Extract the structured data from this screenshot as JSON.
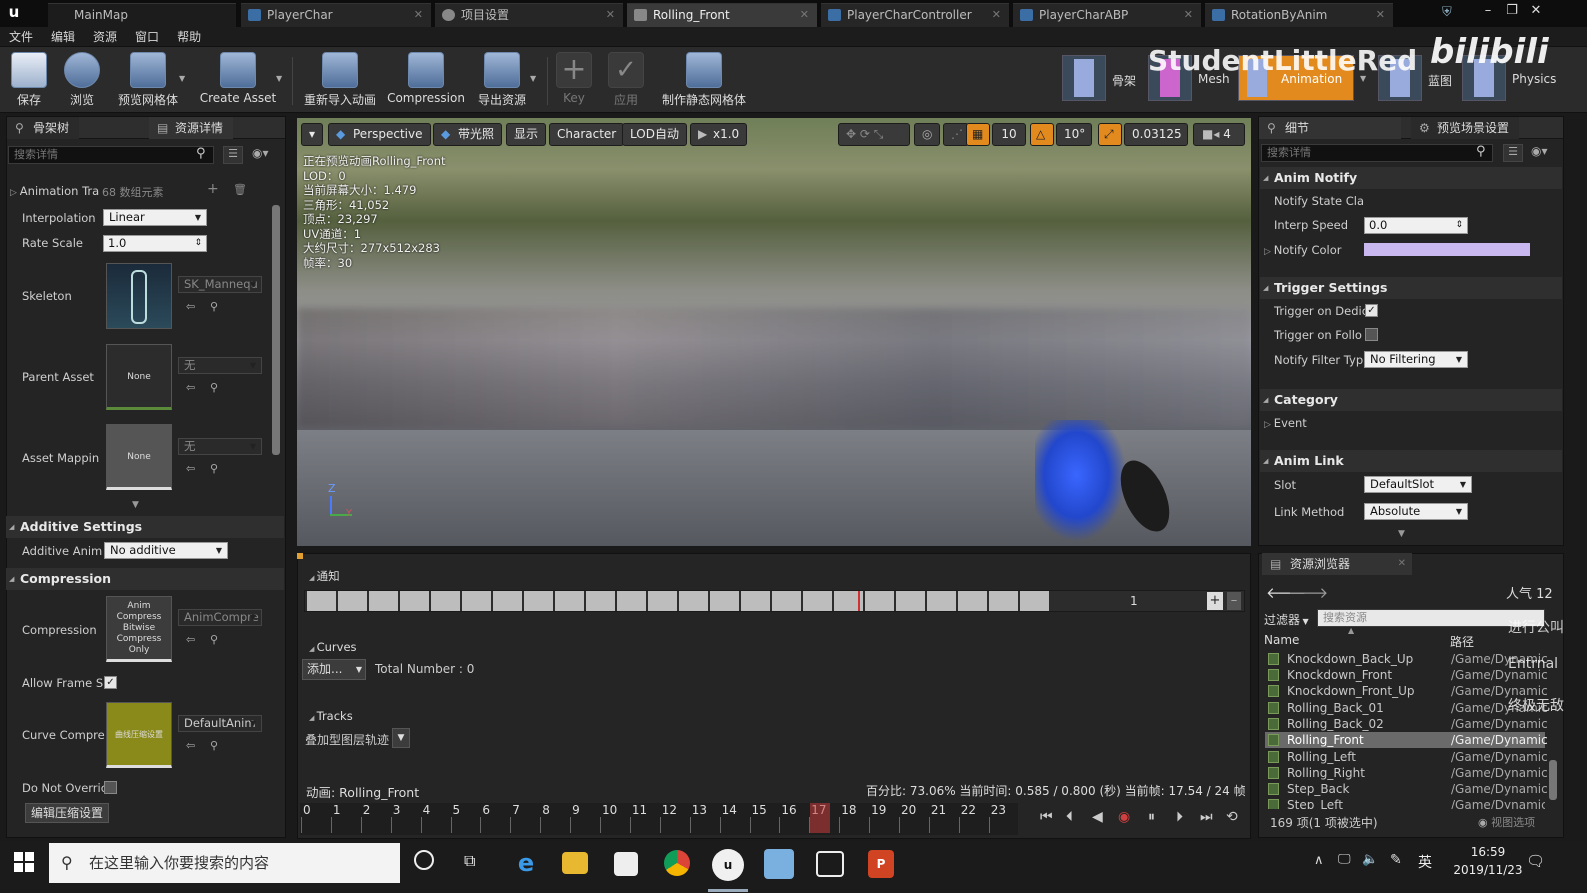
{
  "title_tabs": [
    {
      "label": "MainMap"
    },
    {
      "label": "PlayerChar"
    },
    {
      "label": "项目设置"
    },
    {
      "label": "Rolling_Front"
    },
    {
      "label": "PlayerCharController"
    },
    {
      "label": "PlayerCharABP"
    },
    {
      "label": "RotationByAnim"
    }
  ],
  "menu": [
    "文件",
    "编辑",
    "资源",
    "窗口",
    "帮助"
  ],
  "toolbar": [
    {
      "label": "保存"
    },
    {
      "label": "浏览"
    },
    {
      "label": "预览网格体"
    },
    {
      "label": "Create Asset"
    },
    {
      "label": "重新导入动画"
    },
    {
      "label": "Compression"
    },
    {
      "label": "导出资源"
    },
    {
      "label": "Key"
    },
    {
      "label": "应用"
    },
    {
      "label": "制作静态网格体"
    }
  ],
  "modes": {
    "skeleton": "骨架",
    "mesh": "Mesh",
    "animation": "Animation",
    "blueprint": "蓝图",
    "physics": "Physics"
  },
  "watermark": {
    "text": "StudentLittleRed",
    "logo": "bilibili"
  },
  "left_panel": {
    "tab1": "骨架树",
    "tab2": "资源详情",
    "search_placeholder": "搜索详情",
    "anim_track_label": "Animation Tra",
    "anim_track_count": "68 数组元素",
    "interpolation_label": "Interpolation",
    "interpolation_value": "Linear",
    "rate_scale_label": "Rate Scale",
    "rate_scale_value": "1.0",
    "skeleton_label": "Skeleton",
    "skeleton_value": "SK_Mannequ",
    "parent_asset_label": "Parent Asset",
    "parent_asset_thumb": "None",
    "parent_asset_value": "无",
    "asset_mapping_label": "Asset Mappin",
    "asset_mapping_thumb": "None",
    "asset_mapping_value": "无",
    "additive_section": "Additive Settings",
    "additive_label": "Additive Anim",
    "additive_value": "No additive",
    "compression_section": "Compression",
    "compression_label": "Compression",
    "compression_thumb": "Anim Compress Bitwise Compress Only",
    "compression_value": "AnimCompre",
    "allow_frame_label": "Allow Frame S",
    "curve_compress_label": "Curve Compre",
    "curve_thumb": "曲线压缩设置",
    "curve_value": "DefaultAnim",
    "do_not_override_label": "Do Not Overric",
    "edit_button": "编辑压缩设置"
  },
  "viewport": {
    "menu_btn": "▾",
    "perspective": "Perspective",
    "lit": "带光照",
    "show": "显示",
    "character": "Character",
    "lod": "LOD自动",
    "speed": "x1.0",
    "grid_snap": "10",
    "rot_snap": "10°",
    "scale_snap": "0.03125",
    "cam_speed": "4",
    "info": [
      "正在预览动画Rolling_Front",
      "LOD：0",
      "当前屏幕大小：1.479",
      "三角形：41,052",
      "顶点：23,297",
      "UV通道：1",
      "大约尺寸：277x512x283",
      "帧率：30"
    ],
    "axis_z": "Z",
    "axis_y": "Y"
  },
  "timeline": {
    "notify_label": "通知",
    "notify_track_number": "1",
    "curves_label": "Curves",
    "add_button": "添加...",
    "total_number": "Total Number : 0",
    "tracks_label": "Tracks",
    "additive_track": "叠加型图层轨迹",
    "status_anim": "动画: Rolling_Front",
    "status_info": "百分比: 73.06% 当前时间: 0.585 / 0.800 (秒) 当前帧: 17.54 / 24 帧",
    "ruler": [
      "0",
      "1",
      "2",
      "3",
      "4",
      "5",
      "6",
      "7",
      "8",
      "9",
      "10",
      "11",
      "12",
      "13",
      "14",
      "15",
      "16",
      "17",
      "18",
      "19",
      "20",
      "21",
      "22",
      "23"
    ]
  },
  "details": {
    "tab1": "细节",
    "tab2": "预览场景设置",
    "search_placeholder": "搜索详情",
    "anim_notify": "Anim Notify",
    "notify_state_class": "Notify State Cla",
    "interp_speed_label": "Interp Speed",
    "interp_speed_value": "0.0",
    "notify_color_label": "Notify Color",
    "trigger_settings": "Trigger Settings",
    "trigger_dedicated": "Trigger on Dedic",
    "trigger_follower": "Trigger on Follo",
    "notify_filter_label": "Notify Filter Typ",
    "notify_filter_value": "No Filtering",
    "category": "Category",
    "event": "Event",
    "anim_link": "Anim Link",
    "slot_label": "Slot",
    "slot_value": "DefaultSlot",
    "link_method_label": "Link Method",
    "link_method_value": "Absolute",
    "color_notify": "#c9b8f0"
  },
  "content_browser": {
    "tab": "资源浏览器",
    "popularity": "人气 12",
    "filter": "过滤器",
    "search_placeholder": "搜索资源",
    "col_name": "Name",
    "col_path": "路径",
    "items": [
      {
        "name": "Knockdown_Back_Up",
        "path": "/Game/Dynamic"
      },
      {
        "name": "Knockdown_Front",
        "path": "/Game/Dynamic"
      },
      {
        "name": "Knockdown_Front_Up",
        "path": "/Game/Dynamic"
      },
      {
        "name": "Rolling_Back_01",
        "path": "/Game/Dynamic"
      },
      {
        "name": "Rolling_Back_02",
        "path": "/Game/Dynamic"
      },
      {
        "name": "Rolling_Front",
        "path": "/Game/Dynamic"
      },
      {
        "name": "Rolling_Left",
        "path": "/Game/Dynamic"
      },
      {
        "name": "Rolling_Right",
        "path": "/Game/Dynamic"
      },
      {
        "name": "Step_Back",
        "path": "/Game/Dynamic"
      },
      {
        "name": "Step_Left",
        "path": "/Game/Dynamic"
      }
    ],
    "footer": "169 项(1 项被选中)",
    "view_options": "视图选项",
    "danmaku": [
      "进行公叫",
      "Entrnal",
      "终极无敌"
    ]
  },
  "taskbar": {
    "search_placeholder": "在这里输入你要搜索的内容",
    "ime": "英",
    "time": "16:59",
    "date": "2019/11/23"
  }
}
